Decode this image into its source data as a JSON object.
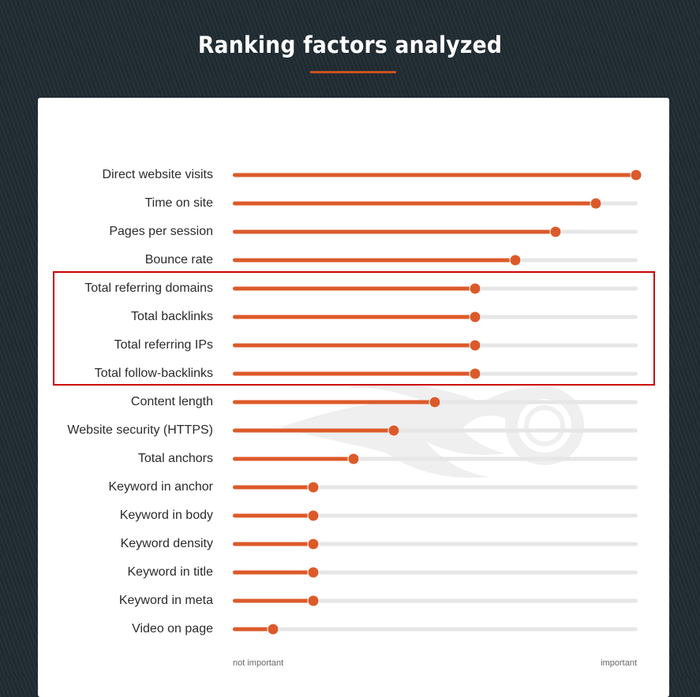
{
  "header": {
    "title": "Ranking factors analyzed"
  },
  "colors": {
    "accent": "#dc5a2a",
    "track": "#e6e6e6",
    "highlight": "#cc0000",
    "background": "#1f2a31"
  },
  "chart_data": {
    "type": "bar",
    "orientation": "horizontal",
    "title": "Ranking factors analyzed",
    "xlabel": "",
    "ylabel": "",
    "xlim": [
      0,
      1
    ],
    "scale_labels": {
      "min": "not important",
      "max": "important"
    },
    "categories": [
      "Direct website visits",
      "Time on site",
      "Pages per session",
      "Bounce rate",
      "Total referring domains",
      "Total backlinks",
      "Total referring IPs",
      "Total follow-backlinks",
      "Content length",
      "Website security (HTTPS)",
      "Total anchors",
      "Keyword in anchor",
      "Keyword in body",
      "Keyword density",
      "Keyword in title",
      "Keyword in meta",
      "Video on page"
    ],
    "values": [
      1.0,
      0.9,
      0.8,
      0.7,
      0.6,
      0.6,
      0.6,
      0.6,
      0.5,
      0.4,
      0.3,
      0.2,
      0.2,
      0.2,
      0.2,
      0.2,
      0.1
    ],
    "highlighted": [
      "Total referring domains",
      "Total backlinks",
      "Total referring IPs",
      "Total follow-backlinks"
    ],
    "grid": false,
    "legend": "none"
  },
  "watermark": {
    "icon": "semrush-fire-logo-icon"
  }
}
